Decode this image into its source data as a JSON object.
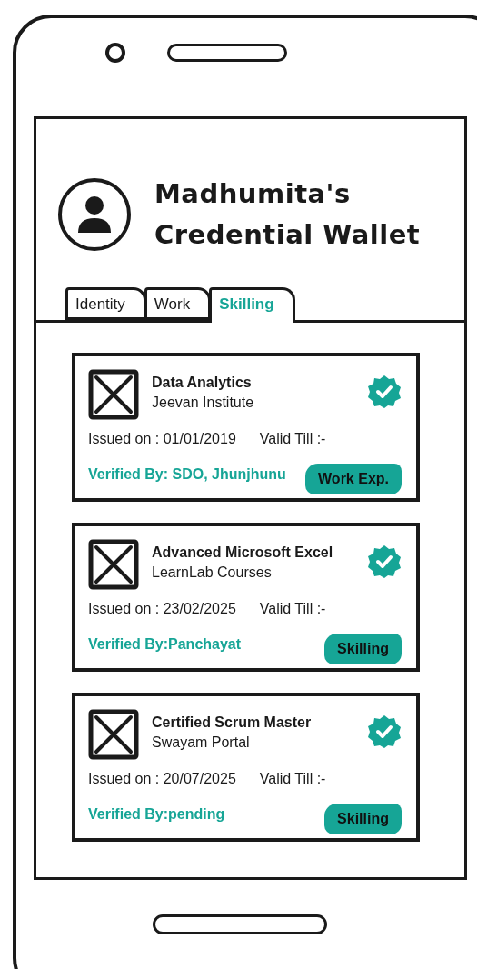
{
  "header": {
    "title_line_1": "Madhumita's",
    "title_line_2": "Credential Wallet"
  },
  "tabs": [
    {
      "label": "Identity",
      "selected": false
    },
    {
      "label": "Work",
      "selected": false
    },
    {
      "label": "Skilling",
      "selected": true
    }
  ],
  "credentials": [
    {
      "title": "Data Analytics",
      "issuer": "Jeevan Institute",
      "issued": "Issued on : 01/01/2019",
      "valid": "Valid Till :-",
      "verified_by": "Verified By: SDO, Jhunjhunu",
      "tag": "Work Exp."
    },
    {
      "title": "Advanced Microsoft Excel",
      "issuer": "LearnLab Courses",
      "issued": "Issued on : 23/02/2025",
      "valid": "Valid Till :-",
      "verified_by": "Verified By:Panchayat",
      "tag": "Skilling"
    },
    {
      "title": "Certified Scrum Master",
      "issuer": "Swayam Portal",
      "issued": "Issued on : 20/07/2025",
      "valid": "Valid Till :-",
      "verified_by": "Verified By:pending",
      "tag": "Skilling"
    }
  ]
}
